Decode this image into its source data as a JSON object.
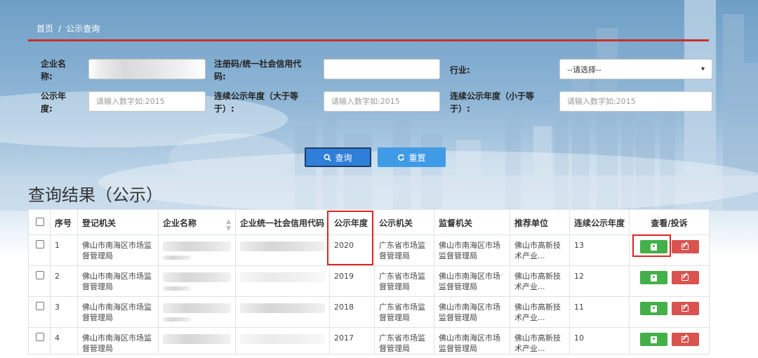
{
  "breadcrumb": {
    "home": "首页",
    "separator": "/",
    "current": "公示查询"
  },
  "form": {
    "company_name_label": "企业名称:",
    "reg_code_label": "注册码/统一社会信用代码:",
    "reg_code_value": "",
    "industry_label": "行业:",
    "industry_selected": "--请选择--",
    "year_label": "公示年度:",
    "year_placeholder": "请输入数字如:2015",
    "cont_min_label": "连续公示年度（大于等于）:",
    "cont_min_placeholder": "请输入数字如:2015",
    "cont_max_label": "连续公示年度（小于等于）:",
    "cont_max_placeholder": "请输入数字如:2015"
  },
  "buttons": {
    "query": "查询",
    "reset": "重置"
  },
  "results": {
    "title": "查询结果（公示）",
    "columns": [
      "序号",
      "登记机关",
      "企业名称",
      "企业统一社会信用代码",
      "公示年度",
      "公示机关",
      "监督机关",
      "推荐单位",
      "连续公示年度",
      "查看/投诉"
    ],
    "rows": [
      {
        "no": "1",
        "reg_org": "佛山市南海区市场监督管理局",
        "year": "2020",
        "pub_org": "广东省市场监督管理局",
        "sup_org": "佛山市南海区市场监督管理局",
        "recommend": "佛山市高新技术产业...",
        "continuous": "13"
      },
      {
        "no": "2",
        "reg_org": "佛山市南海区市场监督管理局",
        "year": "2019",
        "pub_org": "广东省市场监督管理局",
        "sup_org": "佛山市南海区市场监督管理局",
        "recommend": "佛山市高新技术产业...",
        "continuous": "12"
      },
      {
        "no": "3",
        "reg_org": "佛山市南海区市场监督管理局",
        "year": "2018",
        "pub_org": "广东省市场监督管理局",
        "sup_org": "佛山市南海区市场监督管理局",
        "recommend": "佛山市高新技术产业...",
        "continuous": "11"
      },
      {
        "no": "4",
        "reg_org": "佛山市南海区市场监督管理局",
        "year": "2017",
        "pub_org": "广东省市场监督管理局",
        "sup_org": "佛山市南海区市场监督管理局",
        "recommend": "佛山市高新技术产业...",
        "continuous": "10"
      }
    ]
  },
  "colors": {
    "accent_red": "#c9302c",
    "query_blue": "#2f7fd8",
    "reset_blue": "#3f9be6",
    "view_green": "#43b04a",
    "complain_red": "#d9534f",
    "highlight": "#e02424"
  },
  "icons": {
    "query": "search-icon",
    "reset": "refresh-icon",
    "view": "user-card-icon",
    "complain": "edit-icon",
    "sort": "sort-icon"
  }
}
